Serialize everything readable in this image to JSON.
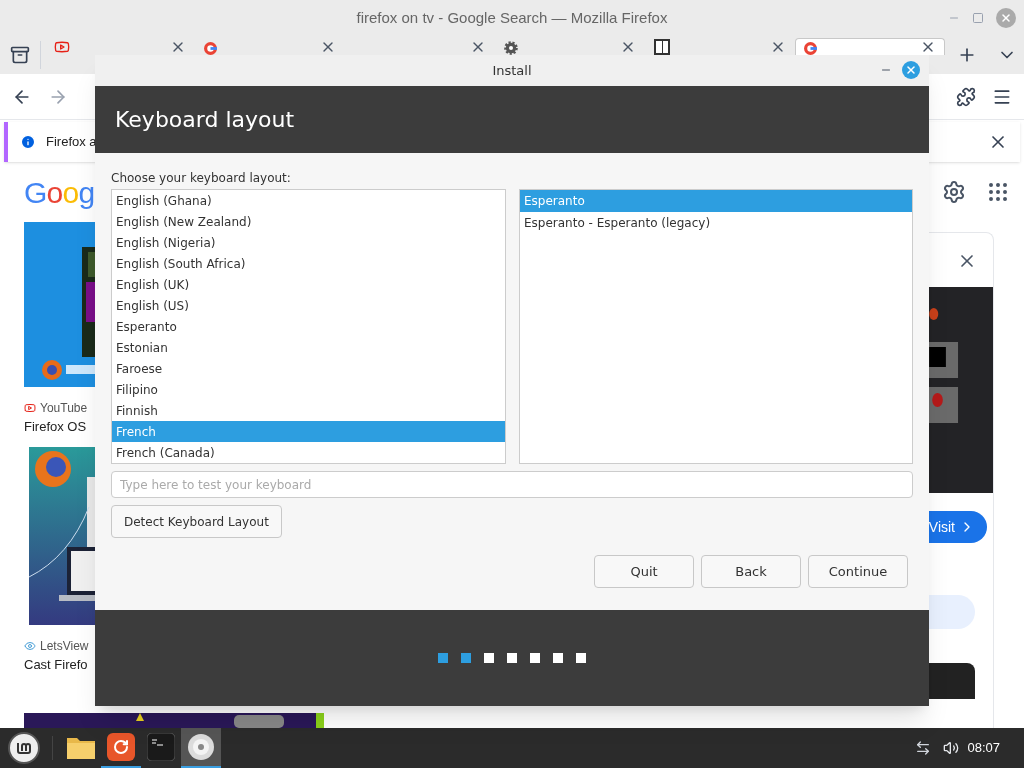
{
  "browser": {
    "title": "firefox on tv - Google Search — Mozilla Firefox",
    "tabs": [
      {
        "kind": "youtube",
        "selected": false
      },
      {
        "kind": "google",
        "selected": false
      },
      {
        "kind": "none",
        "selected": false
      },
      {
        "kind": "gear",
        "selected": false
      },
      {
        "kind": "windows",
        "selected": false
      },
      {
        "kind": "google",
        "selected": true
      }
    ],
    "notification": "Firefox a",
    "page": {
      "logo": "Goog",
      "results": [
        {
          "kind": "youtube",
          "source": "YouTube",
          "title": "Firefox OS"
        },
        {
          "kind": "letsview",
          "source": "LetsView",
          "title": "Cast Firefo"
        }
      ],
      "visit": "Visit"
    }
  },
  "installer": {
    "title": "Install",
    "heading": "Keyboard layout",
    "prompt": "Choose your keyboard layout:",
    "layouts": [
      {
        "label": "English (Ghana)",
        "selected": false
      },
      {
        "label": "English (New Zealand)",
        "selected": false
      },
      {
        "label": "English (Nigeria)",
        "selected": false
      },
      {
        "label": "English (South Africa)",
        "selected": false
      },
      {
        "label": "English (UK)",
        "selected": false
      },
      {
        "label": "English (US)",
        "selected": false
      },
      {
        "label": "Esperanto",
        "selected": false
      },
      {
        "label": "Estonian",
        "selected": false
      },
      {
        "label": "Faroese",
        "selected": false
      },
      {
        "label": "Filipino",
        "selected": false
      },
      {
        "label": "Finnish",
        "selected": false
      },
      {
        "label": "French",
        "selected": true
      },
      {
        "label": "French (Canada)",
        "selected": false
      }
    ],
    "variants": [
      {
        "label": "Esperanto",
        "selected": true
      },
      {
        "label": "Esperanto - Esperanto (legacy)",
        "selected": false
      }
    ],
    "test_field": {
      "placeholder": "Type here to test your keyboard"
    },
    "detect_button": "Detect Keyboard Layout",
    "buttons": [
      "Quit",
      "Back",
      "Continue"
    ],
    "steps": [
      {
        "done": true
      },
      {
        "done": true
      },
      {
        "done": false
      },
      {
        "done": false
      },
      {
        "done": false
      },
      {
        "done": false
      },
      {
        "done": false
      }
    ]
  },
  "taskbar": {
    "apps": [
      {
        "kind": "files",
        "running": false,
        "focused": false
      },
      {
        "kind": "firefox",
        "running": true,
        "focused": false
      },
      {
        "kind": "terminal",
        "running": false,
        "focused": false
      },
      {
        "kind": "disc",
        "running": true,
        "focused": true
      }
    ],
    "clock": "08:07"
  }
}
